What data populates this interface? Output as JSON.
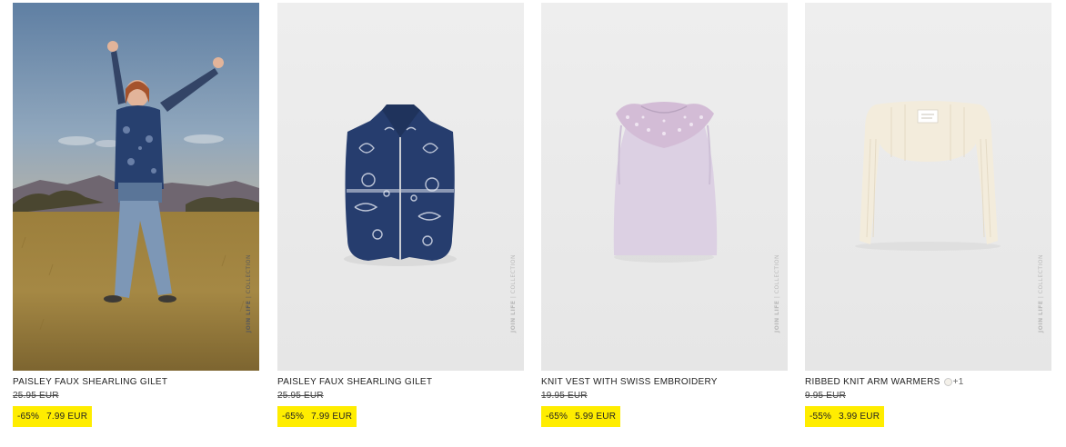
{
  "products": [
    {
      "name": "PAISLEY FAUX SHEARLING GILET",
      "image_label": "JOIN LIFE",
      "image_label_suffix": " | COLLECTION",
      "old_price": "25.95 EUR",
      "discount": "-65%",
      "sale_price": "7.99 EUR",
      "image": "girl-in-field-photo"
    },
    {
      "name": "PAISLEY FAUX SHEARLING GILET",
      "image_label": "JOIN LIFE",
      "image_label_suffix": " | COLLECTION",
      "old_price": "25.95 EUR",
      "discount": "-65%",
      "sale_price": "7.99 EUR",
      "image": "paisley-gilet-photo"
    },
    {
      "name": "KNIT VEST WITH SWISS EMBROIDERY",
      "image_label": "JOIN LIFE",
      "image_label_suffix": " | COLLECTION",
      "old_price": "19.95 EUR",
      "discount": "-65%",
      "sale_price": "5.99 EUR",
      "image": "lilac-knit-vest-photo"
    },
    {
      "name": "RIBBED KNIT ARM WARMERS",
      "extra_colors": "+1",
      "image_label": "JOIN LIFE",
      "image_label_suffix": " | COLLECTION",
      "old_price": "9.95 EUR",
      "discount": "-55%",
      "sale_price": "3.99 EUR",
      "image": "cream-arm-warmers-photo"
    }
  ],
  "colors": {
    "sale_highlight": "#ffed00",
    "text": "#222222",
    "image_background": "#e9e9e9"
  }
}
